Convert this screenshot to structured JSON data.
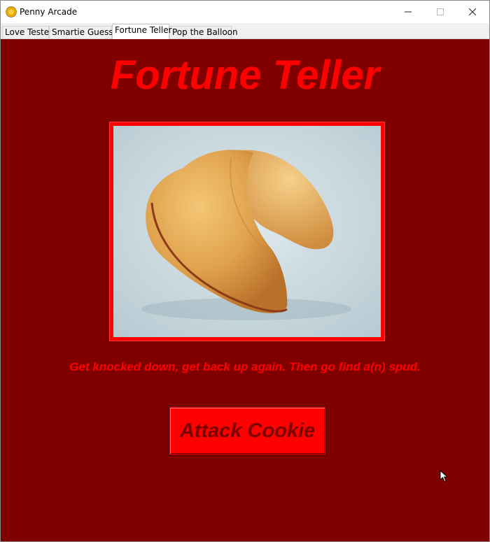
{
  "window": {
    "title": "Penny Arcade",
    "controls": {
      "minimize": "—",
      "maximize": "☐",
      "close": "✕"
    }
  },
  "tabs": [
    {
      "label": "Love Tester",
      "active": false
    },
    {
      "label": "Smartie Guesser",
      "active": false
    },
    {
      "label": "Fortune Teller",
      "active": true
    },
    {
      "label": "Pop the Balloon",
      "active": false
    }
  ],
  "main": {
    "heading": "Fortune Teller",
    "fortune_text": "Get knocked down, get back up again. Then go find a(n) spud.",
    "button_label": "Attack Cookie",
    "image_subject": "fortune cookie"
  },
  "colors": {
    "background": "#800000",
    "accent": "#ff0000",
    "button_text": "#7a0000"
  }
}
